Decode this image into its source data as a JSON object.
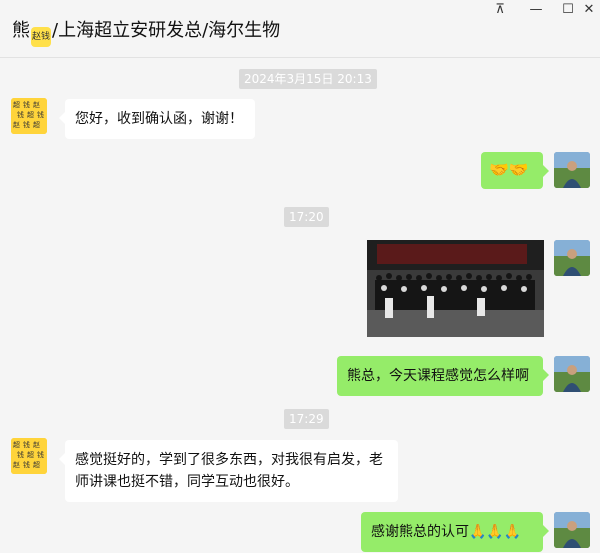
{
  "header": {
    "name_prefix": "熊",
    "name_emoji": "赵钱",
    "name_suffix": "/上海超立安研发总/海尔生物",
    "window_controls": {
      "pin": "⊼",
      "minimize": "—",
      "maximize": "☐",
      "close": "✕"
    }
  },
  "chat": {
    "timestamps": [
      "2024年3月15日 20:13",
      "17:20",
      "17:29"
    ],
    "messages": [
      {
        "side": "left",
        "text": "您好，收到确认函，谢谢！"
      },
      {
        "side": "right",
        "text": "🤝🤝"
      },
      {
        "side": "right",
        "type": "image",
        "banner_text": "2024年上海 高级研修班 · 第七期课程现场 · 合影留念"
      },
      {
        "side": "right",
        "text": "熊总，今天课程感觉怎么样啊"
      },
      {
        "side": "left",
        "text": "感觉挺好的，学到了很多东西，对我很有启发，老师讲课也挺不错，同学互动也很好。"
      },
      {
        "side": "right",
        "text": "感谢熊总的认可🙏🙏🙏"
      }
    ]
  },
  "colors": {
    "background": "#f5f5f5",
    "bubble_mine": "#95ec69",
    "bubble_theirs": "#ffffff",
    "timestamp_bg": "#dadada"
  },
  "icons": [
    "pin-icon",
    "minimize-icon",
    "maximize-icon",
    "close-icon"
  ]
}
